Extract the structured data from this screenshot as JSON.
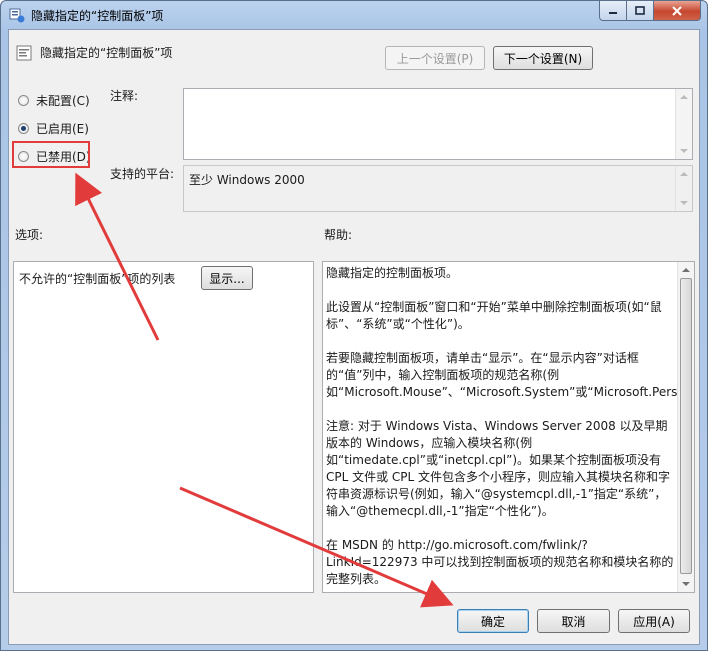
{
  "window": {
    "title": "隐藏指定的“控制面板”项",
    "controls": {
      "minimize": "—",
      "maximize": "□",
      "close": "✕"
    }
  },
  "header": {
    "policy_title": "隐藏指定的“控制面板”项",
    "prev_button": "上一个设置(P)",
    "next_button": "下一个设置(N)"
  },
  "state": {
    "options": [
      {
        "label": "未配置(C)",
        "checked": false
      },
      {
        "label": "已启用(E)",
        "checked": true
      },
      {
        "label": "已禁用(D)",
        "checked": false
      }
    ]
  },
  "comment": {
    "label": "注释:",
    "value": ""
  },
  "platform": {
    "label": "支持的平台:",
    "value": "至少 Windows 2000"
  },
  "options_panel": {
    "label": "选项:",
    "item_text": "不允许的“控制面板”项的列表",
    "show_button": "显示..."
  },
  "help_panel": {
    "label": "帮助:",
    "paragraphs": [
      "隐藏指定的控制面板项。",
      "此设置从“控制面板”窗口和“开始”菜单中删除控制面板项(如“鼠标”、“系统”或“个性化”)。",
      "若要隐藏控制面板项，请单击“显示”。在“显示内容”对话框的“值”列中，输入控制面板项的规范名称(例如“Microsoft.Mouse”、“Microsoft.System”或“Microsoft.Personalization”)。",
      "注意: 对于 Windows Vista、Windows Server 2008 以及早期版本的 Windows，应输入模块名称(例如“timedate.cpl”或“inetcpl.cpl”)。如果某个控制面板项没有 CPL 文件或 CPL 文件包含多个小程序，则应输入其模块名称和字符串资源标识号(例如，输入“@systemcpl.dll,-1”指定“系统”，输入“@themecpl.dll,-1”指定“个性化”)。",
      "在 MSDN 的 http://go.microsoft.com/fwlink/?LinkId=122973 中可以找到控制面板项的规范名称和模块名称的完整列表。"
    ]
  },
  "footer": {
    "ok_button": "确定",
    "cancel_button": "取消",
    "apply_button": "应用(A)"
  },
  "annotations": {
    "highlight_color": "#e23b3b"
  }
}
